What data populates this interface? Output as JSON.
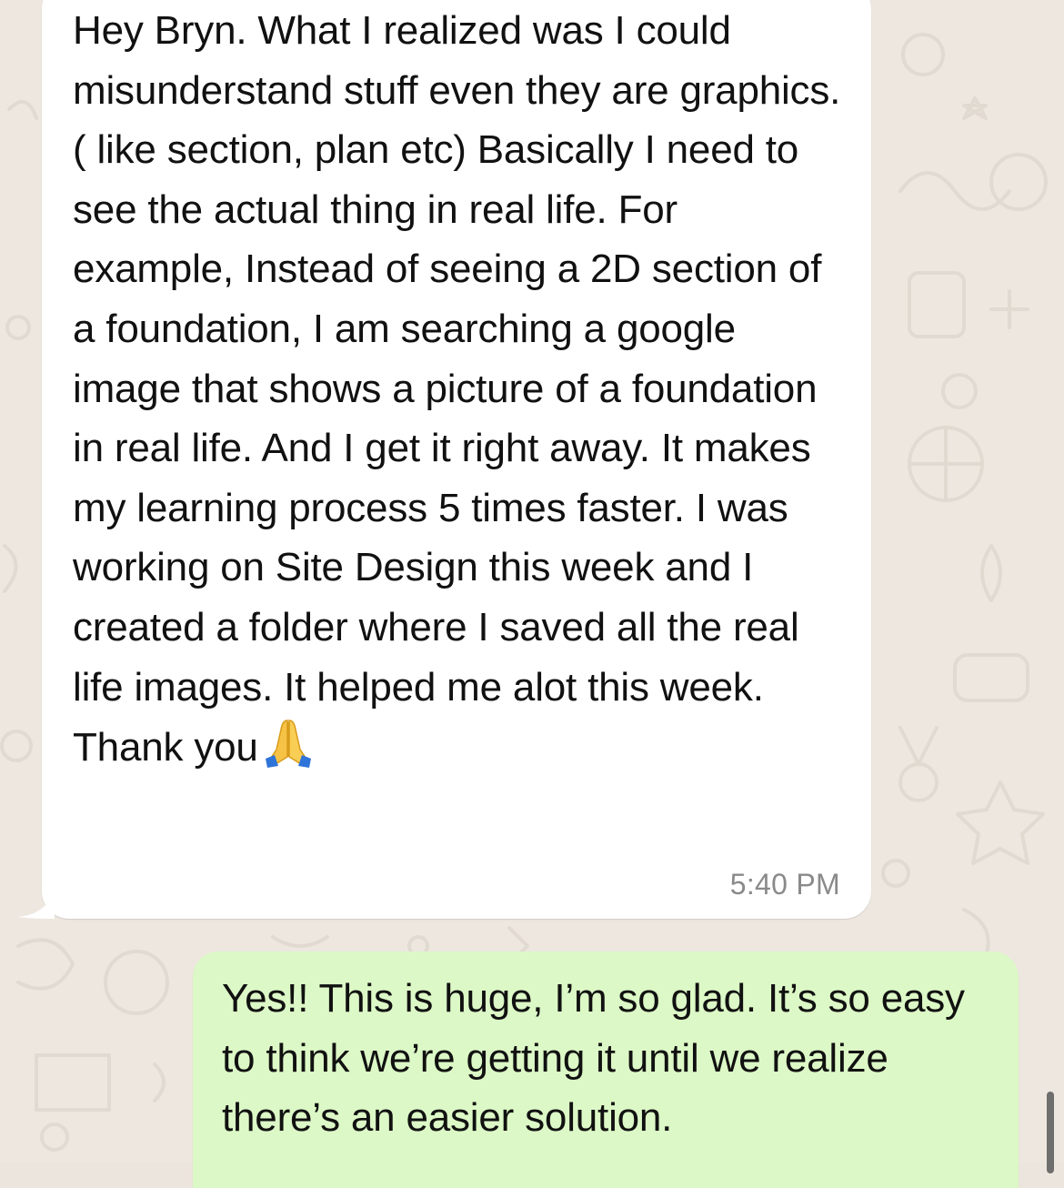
{
  "conversation": {
    "incoming": {
      "text": "Hey Bryn. What I realized was I could misunderstand stuff even they are graphics. ( like section, plan etc) Basically I need to see the actual thing in real life. For example, Instead of seeing a 2D section of a foundation, I am searching a google image that shows a picture of a foundation in real life. And I get it right away. It makes my learning process 5 times faster. I was working on Site Design this week and I created a folder where I saved all the real life images. It helped me alot this week. Thank you",
      "emoji": "folded-hands",
      "time": "5:40 PM"
    },
    "outgoing": {
      "text": "Yes!! This is huge, I’m so glad. It’s so easy to think we’re getting it until we realize there’s an easier solution."
    }
  },
  "colors": {
    "chat_background": "#EDE7DF",
    "incoming_bubble": "#FFFFFF",
    "outgoing_bubble": "#DCF8C6",
    "timestamp": "#8A8A8A"
  }
}
